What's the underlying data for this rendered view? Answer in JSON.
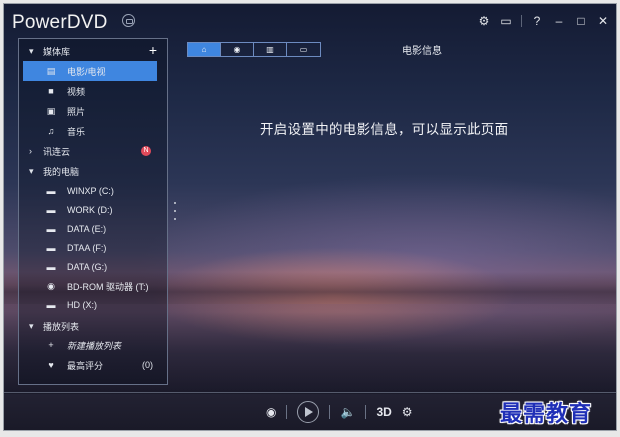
{
  "app": {
    "title": "PowerDVD"
  },
  "sidebar": {
    "media_library": {
      "label": "媒体库"
    },
    "items": [
      {
        "label": "电影/电视",
        "icon": "film-icon",
        "active": true
      },
      {
        "label": "视频",
        "icon": "video-camera-icon"
      },
      {
        "label": "照片",
        "icon": "photo-icon"
      },
      {
        "label": "音乐",
        "icon": "music-note-icon"
      }
    ],
    "cloud": {
      "label": "讯连云",
      "badge": "N"
    },
    "my_computer": {
      "label": "我的电脑",
      "drives": [
        {
          "label": "WINXP (C:)",
          "icon": "hard-drive-icon"
        },
        {
          "label": "WORK (D:)",
          "icon": "hard-drive-icon"
        },
        {
          "label": "DATA (E:)",
          "icon": "hard-drive-icon"
        },
        {
          "label": "DTAA (F:)",
          "icon": "hard-drive-icon"
        },
        {
          "label": "DATA (G:)",
          "icon": "hard-drive-icon"
        },
        {
          "label": "BD-ROM 驱动器 (T:)",
          "icon": "disc-icon"
        },
        {
          "label": "HD (X:)",
          "icon": "hard-drive-icon"
        }
      ]
    },
    "playlists": {
      "label": "播放列表",
      "new_label": "新建播放列表",
      "favorites_label": "最高评分",
      "favorites_count": "(0)"
    }
  },
  "tabs": [
    {
      "name": "home",
      "icon": "home-icon",
      "selected": true
    },
    {
      "name": "disc",
      "icon": "disc-icon"
    },
    {
      "name": "movie",
      "icon": "film-strip-icon"
    },
    {
      "name": "tv",
      "icon": "tv-icon"
    }
  ],
  "main": {
    "section_title": "电影信息",
    "message": "开启设置中的电影信息，可以显示此页面"
  },
  "controls": {
    "three_d": "3D"
  },
  "watermark": {
    "text": "最需教育"
  },
  "colors": {
    "accent": "#3f86e0",
    "badge": "#e04a5a",
    "watermark": "#1f2fb7"
  }
}
